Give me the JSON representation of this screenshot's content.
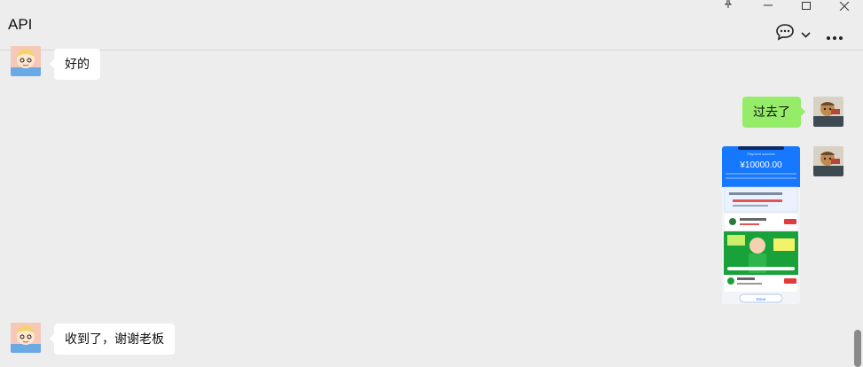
{
  "window": {
    "title": "API",
    "controls": {
      "pin": "pin-icon",
      "minimize": "minimize-icon",
      "maximize": "maximize-icon",
      "close": "close-icon"
    }
  },
  "toolbar": {
    "chat_icon": "chat-bubble-icon",
    "dropdown_icon": "chevron-down-icon",
    "more_icon": "more-icon"
  },
  "messages": [
    {
      "side": "in",
      "text": "好的"
    },
    {
      "side": "out",
      "text": "过去了"
    },
    {
      "side": "out",
      "type": "image",
      "image": {
        "header": "Payment success",
        "amount": "¥10000.00",
        "done_label": "Done"
      }
    },
    {
      "side": "in",
      "text": "收到了，谢谢老板"
    }
  ],
  "colors": {
    "background": "#ededed",
    "incoming_bubble": "#ffffff",
    "outgoing_bubble": "#95ec69",
    "payment_blue": "#1677ff",
    "ad_green": "#1aa23a"
  }
}
